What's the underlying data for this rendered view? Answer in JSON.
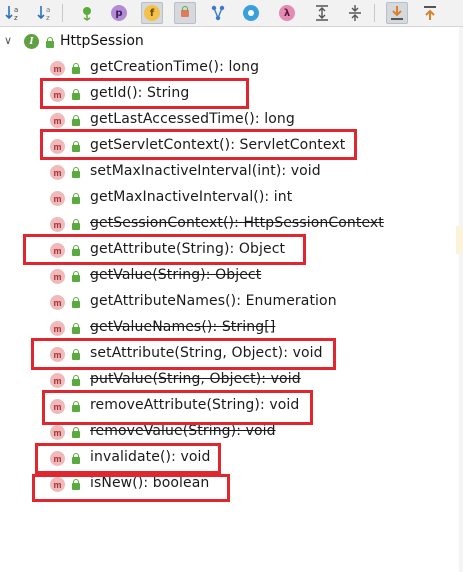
{
  "toolbar": {
    "buttons": [
      {
        "name": "sort-visibility-icon",
        "glyph": "↓ᵃ",
        "active": false
      },
      {
        "name": "sort-alpha-icon",
        "glyph": "↓ᶻ",
        "active": false
      },
      {
        "name": "show-fields-icon",
        "glyph": "f",
        "active": false
      },
      {
        "name": "show-properties-icon",
        "glyph": "p",
        "active": false
      },
      {
        "name": "show-fields-active-icon",
        "glyph": "f",
        "active": true
      },
      {
        "name": "show-non-public-icon",
        "glyph": "",
        "active": true
      },
      {
        "name": "inherited-icon",
        "glyph": "Y",
        "active": false
      },
      {
        "name": "anonymous-classes-icon",
        "glyph": "◎",
        "active": false
      },
      {
        "name": "lambdas-icon",
        "glyph": "λ",
        "active": false
      },
      {
        "name": "expand-all-icon",
        "glyph": "⇞",
        "active": false
      },
      {
        "name": "collapse-all-icon",
        "glyph": "⇟",
        "active": false
      },
      {
        "name": "autoscroll-to-source-icon",
        "glyph": "⤓",
        "active": true
      },
      {
        "name": "autoscroll-from-source-icon",
        "glyph": "⤒",
        "active": false
      }
    ]
  },
  "tree": {
    "root": {
      "label": "HttpSession",
      "badge": "I"
    },
    "method_badge": "m",
    "items": [
      {
        "label": "getCreationTime(): long",
        "deprecated": false
      },
      {
        "label": "getId(): String",
        "deprecated": false
      },
      {
        "label": "getLastAccessedTime(): long",
        "deprecated": false
      },
      {
        "label": "getServletContext(): ServletContext",
        "deprecated": false
      },
      {
        "label": "setMaxInactiveInterval(int): void",
        "deprecated": false
      },
      {
        "label": "getMaxInactiveInterval(): int",
        "deprecated": false
      },
      {
        "label": "getSessionContext(): HttpSessionContext",
        "deprecated": true
      },
      {
        "label": "getAttribute(String): Object",
        "deprecated": false
      },
      {
        "label": "getValue(String): Object",
        "deprecated": true
      },
      {
        "label": "getAttributeNames(): Enumeration",
        "deprecated": false
      },
      {
        "label": "getValueNames(): String[]",
        "deprecated": true
      },
      {
        "label": "setAttribute(String, Object): void",
        "deprecated": false
      },
      {
        "label": "putValue(String, Object): void",
        "deprecated": true
      },
      {
        "label": "removeAttribute(String): void",
        "deprecated": false
      },
      {
        "label": "removeValue(String): void",
        "deprecated": true
      },
      {
        "label": "invalidate(): void",
        "deprecated": false
      },
      {
        "label": "isNew(): boolean",
        "deprecated": false
      }
    ]
  },
  "colors": {
    "highlight": "#e0262f",
    "method_badge_bg": "#f1b9b9",
    "interface_badge_bg": "#5fa040",
    "lock": "#5aab3d"
  }
}
